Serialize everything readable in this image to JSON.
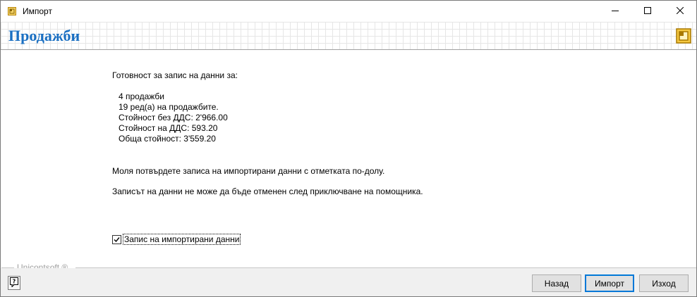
{
  "window": {
    "title": "Импорт",
    "icons": {
      "app": "app-icon",
      "minimize": "minimize-icon",
      "maximize": "maximize-icon",
      "close": "close-icon"
    }
  },
  "header": {
    "title": "Продажби",
    "logo": "unicontsoft-logo",
    "title_color": "#1a6fc2"
  },
  "content": {
    "ready_line": "Готовност за запис на данни за:",
    "stats": [
      "4 продажби",
      "19 ред(а) на продажбите.",
      "Стойност без ДДС: 2'966.00",
      "Стойност на ДДС: 593.20",
      "Обща стойност: 3'559.20"
    ],
    "confirm_line": "Моля потвърдете записа на импортирани данни с отметката по-долу.",
    "warning_line": "Записът на данни не може да бъде отменен след приключване на помощника.",
    "checkbox": {
      "label": "Запис на импортирани данни",
      "checked": true
    }
  },
  "footer": {
    "brand": "Unicontsoft ®",
    "help_icon": "help-icon",
    "buttons": {
      "back": "Назад",
      "import": "Импорт",
      "exit": "Изход"
    },
    "accent": "#0078d7"
  }
}
